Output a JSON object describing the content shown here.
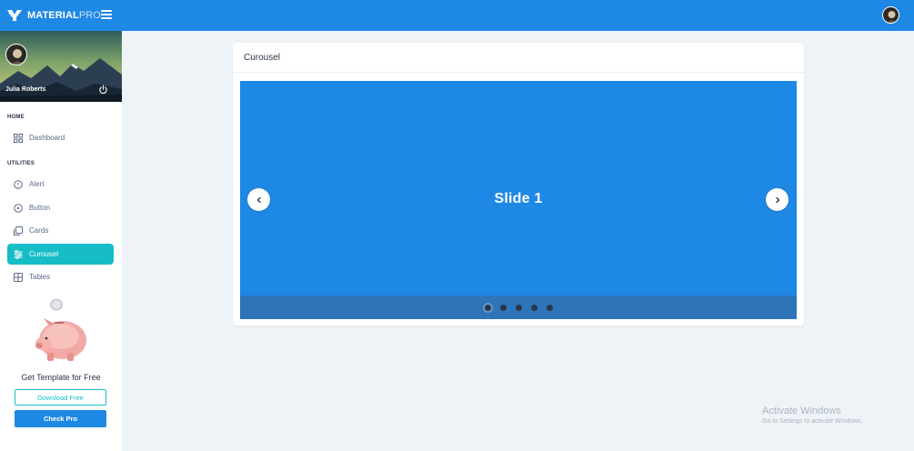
{
  "header": {
    "brand_bold": "MATERIAL",
    "brand_light": "PRO"
  },
  "sidebar": {
    "user_name": "Julia Roberts",
    "sections": [
      {
        "caption": "HOME"
      },
      {
        "caption": "UTILITIES"
      }
    ],
    "items": [
      {
        "label": "Dashboard",
        "icon": "dashboard-icon"
      },
      {
        "label": "Alert",
        "icon": "alert-circle-icon"
      },
      {
        "label": "Button",
        "icon": "circle-dot-icon"
      },
      {
        "label": "Cards",
        "icon": "cards-icon"
      },
      {
        "label": "Curousel",
        "icon": "sliders-icon",
        "active": true
      },
      {
        "label": "Tables",
        "icon": "table-icon"
      }
    ],
    "promo": {
      "text": "Get Template for Free",
      "download_label": "Download Free",
      "pro_label": "Check Pro"
    }
  },
  "main": {
    "card_title": "Curousel",
    "carousel": {
      "slide_label": "Slide 1",
      "slide_count": 5,
      "active_index": 0
    }
  },
  "watermark": {
    "title": "Activate Windows",
    "subtitle": "Go to Settings to activate Windows."
  },
  "colors": {
    "primary": "#1e88e5",
    "accent": "#16bdc6",
    "page_background": "#eef3f7"
  }
}
